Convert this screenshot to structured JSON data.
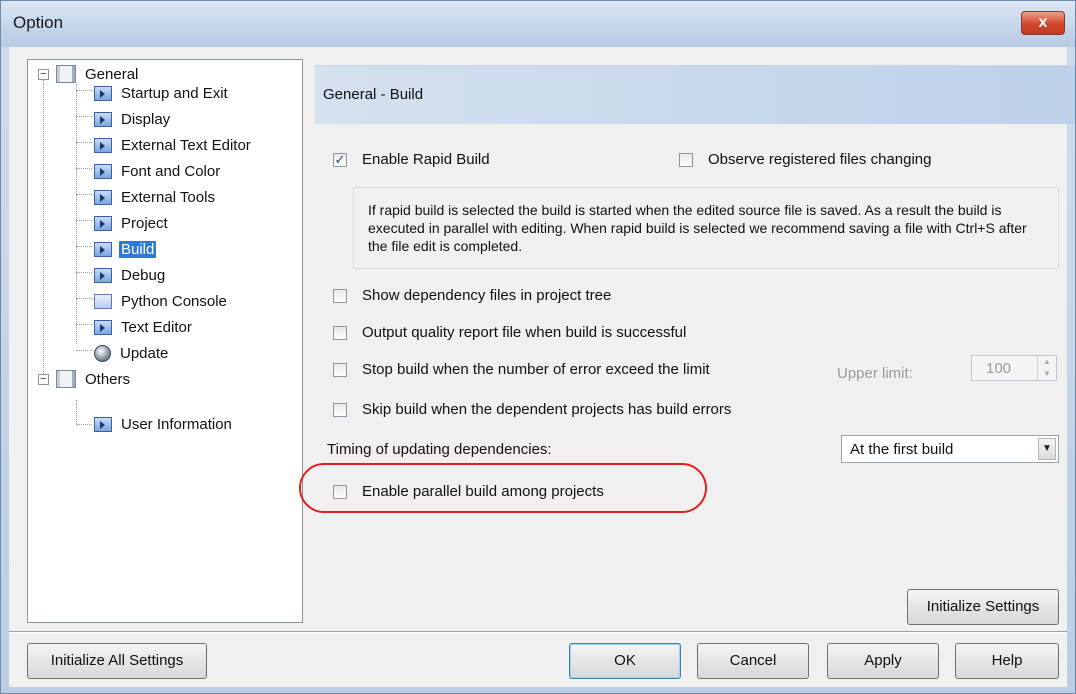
{
  "window": {
    "title": "Option",
    "close_glyph": "x"
  },
  "tree": {
    "items": [
      {
        "label": "General",
        "type": "folder",
        "expander": "−"
      },
      {
        "label": "Startup and Exit",
        "type": "page"
      },
      {
        "label": "Display",
        "type": "page"
      },
      {
        "label": "External Text Editor",
        "type": "page"
      },
      {
        "label": "Font and Color",
        "type": "page"
      },
      {
        "label": "External Tools",
        "type": "page"
      },
      {
        "label": "Project",
        "type": "page"
      },
      {
        "label": "Build",
        "type": "page",
        "selected": true
      },
      {
        "label": "Debug",
        "type": "page"
      },
      {
        "label": "Python Console",
        "type": "console"
      },
      {
        "label": "Text Editor",
        "type": "page"
      },
      {
        "label": "Update",
        "type": "globe"
      },
      {
        "label": "Others",
        "type": "folder",
        "expander": "−"
      },
      {
        "label": "User Information",
        "type": "page"
      }
    ]
  },
  "panel": {
    "header": "General - Build",
    "enable_rapid_build": {
      "label": "Enable Rapid Build",
      "checked": true,
      "glyph": "✓"
    },
    "observe_files": {
      "label": "Observe registered files changing",
      "checked": false
    },
    "description": "If rapid build is selected the build is started when the edited source file is saved. As a result the build is executed in parallel with editing. When rapid build is selected we recommend saving a file with Ctrl+S after the file edit is completed.",
    "show_dependency": {
      "label": "Show dependency files in project tree",
      "checked": false
    },
    "output_quality": {
      "label": "Output quality report file when build is successful",
      "checked": false
    },
    "stop_build": {
      "label": "Stop build when the number of error exceed the limit",
      "checked": false
    },
    "upper_limit": {
      "label": "Upper limit:",
      "value": "100",
      "arrow_up": "▲",
      "arrow_down": "▼"
    },
    "skip_build": {
      "label": "Skip build when the dependent projects has build errors",
      "checked": false
    },
    "timing": {
      "label": "Timing of updating dependencies:",
      "value": "At the first build",
      "arrow": "▼"
    },
    "parallel_build": {
      "label": "Enable parallel build among projects",
      "checked": false
    },
    "initialize_settings": "Initialize Settings"
  },
  "footer": {
    "initialize_all": "Initialize All Settings",
    "ok": "OK",
    "cancel": "Cancel",
    "apply": "Apply",
    "help": "Help"
  },
  "colors": {
    "highlight": "#e02020",
    "selection": "#3179d8"
  }
}
